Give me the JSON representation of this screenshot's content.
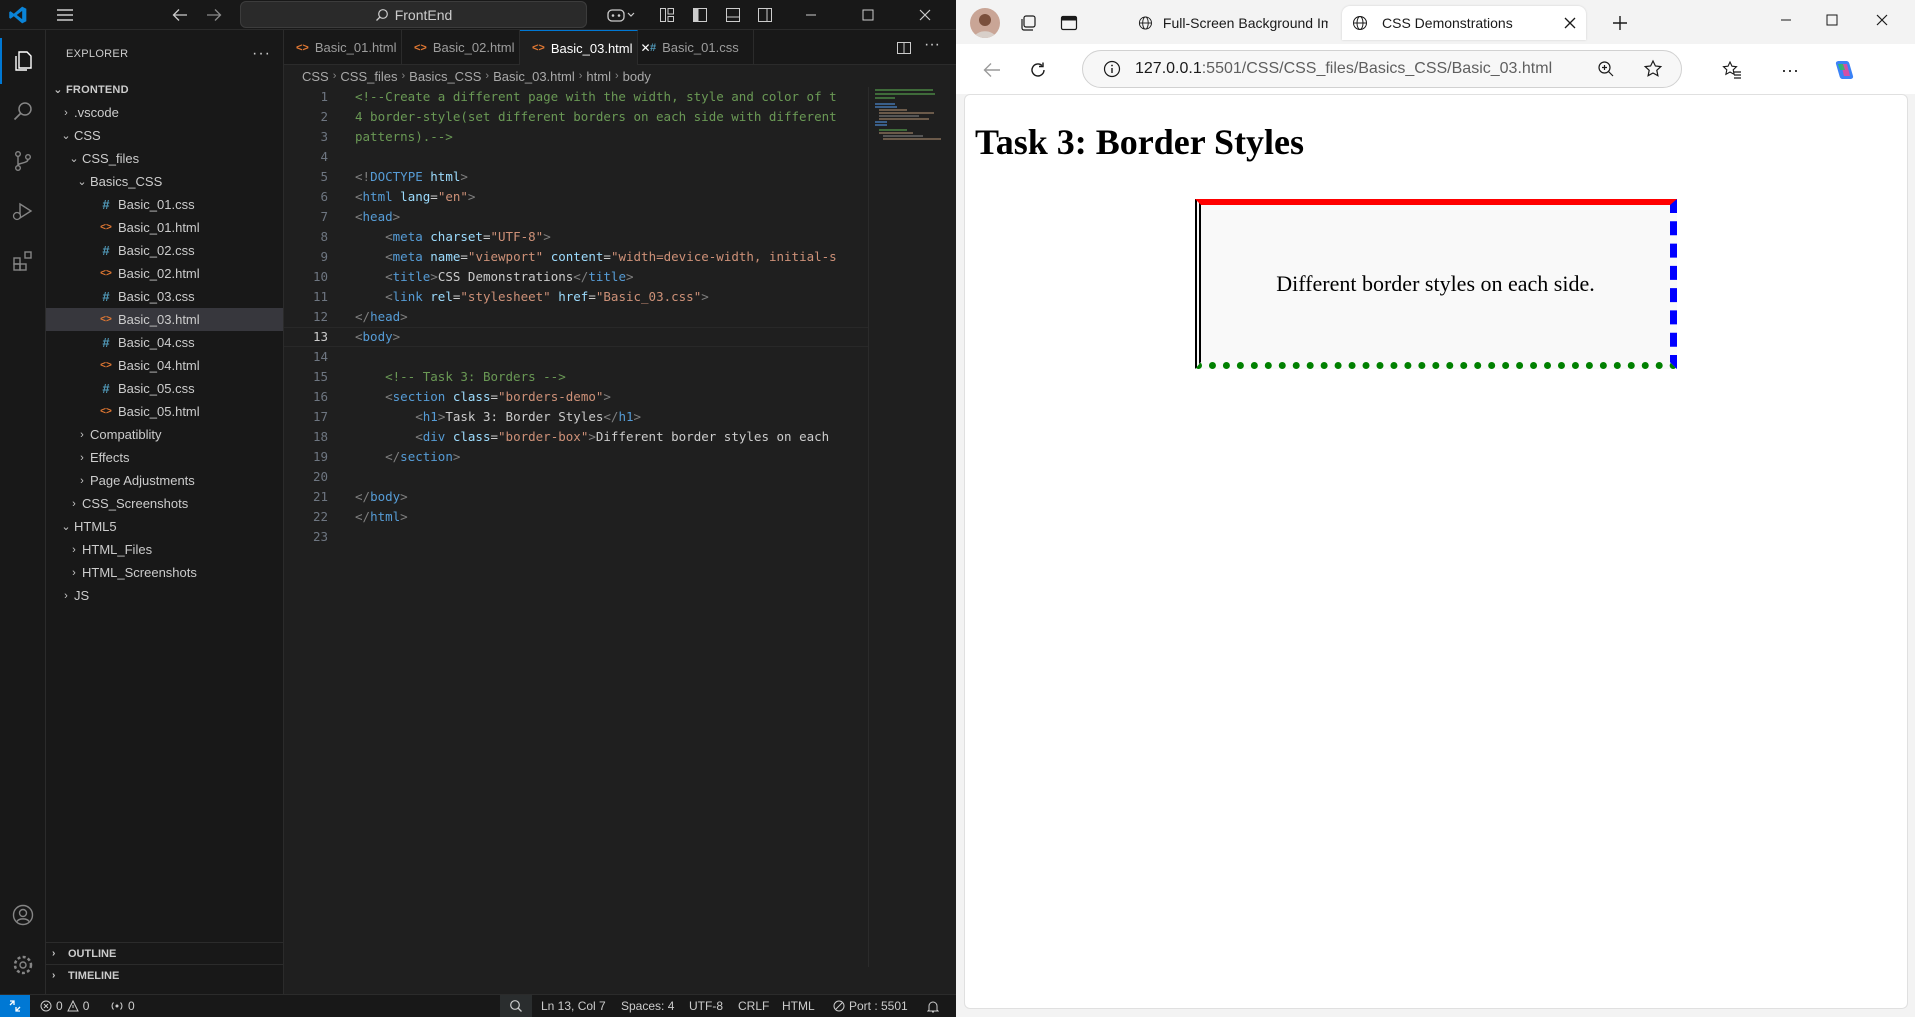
{
  "vscode": {
    "search_label": "FrontEnd",
    "explorer_title": "EXPLORER",
    "root_folder": "FRONTEND",
    "tree": [
      {
        "label": ".vscode",
        "type": "folder",
        "depth": 1,
        "open": false
      },
      {
        "label": "CSS",
        "type": "folder",
        "depth": 1,
        "open": true
      },
      {
        "label": "CSS_files",
        "type": "folder",
        "depth": 2,
        "open": true
      },
      {
        "label": "Basics_CSS",
        "type": "folder",
        "depth": 3,
        "open": true
      },
      {
        "label": "Basic_01.css",
        "type": "css",
        "depth": 4
      },
      {
        "label": "Basic_01.html",
        "type": "html",
        "depth": 4
      },
      {
        "label": "Basic_02.css",
        "type": "css",
        "depth": 4
      },
      {
        "label": "Basic_02.html",
        "type": "html",
        "depth": 4
      },
      {
        "label": "Basic_03.css",
        "type": "css",
        "depth": 4
      },
      {
        "label": "Basic_03.html",
        "type": "html",
        "depth": 4,
        "selected": true
      },
      {
        "label": "Basic_04.css",
        "type": "css",
        "depth": 4
      },
      {
        "label": "Basic_04.html",
        "type": "html",
        "depth": 4
      },
      {
        "label": "Basic_05.css",
        "type": "css",
        "depth": 4
      },
      {
        "label": "Basic_05.html",
        "type": "html",
        "depth": 4
      },
      {
        "label": "Compatiblity",
        "type": "folder",
        "depth": 3,
        "open": false
      },
      {
        "label": "Effects",
        "type": "folder",
        "depth": 3,
        "open": false
      },
      {
        "label": "Page Adjustments",
        "type": "folder",
        "depth": 3,
        "open": false
      },
      {
        "label": "CSS_Screenshots",
        "type": "folder",
        "depth": 2,
        "open": false
      },
      {
        "label": "HTML5",
        "type": "folder",
        "depth": 1,
        "open": true
      },
      {
        "label": "HTML_Files",
        "type": "folder",
        "depth": 2,
        "open": false
      },
      {
        "label": "HTML_Screenshots",
        "type": "folder",
        "depth": 2,
        "open": false
      },
      {
        "label": "JS",
        "type": "folder",
        "depth": 1,
        "open": false
      }
    ],
    "outline_label": "OUTLINE",
    "timeline_label": "TIMELINE",
    "tabs": [
      {
        "label": "Basic_01.html",
        "type": "html",
        "active": false
      },
      {
        "label": "Basic_02.html",
        "type": "html",
        "active": false
      },
      {
        "label": "Basic_03.html",
        "type": "html",
        "active": true
      },
      {
        "label": "Basic_01.css",
        "type": "css",
        "active": false
      }
    ],
    "breadcrumb": [
      "CSS",
      "CSS_files",
      "Basics_CSS",
      "Basic_03.html",
      "html",
      "body"
    ],
    "current_line": 13,
    "code": [
      [
        [
          "c-com",
          "<!--Create a different page with the width, style and color of t"
        ]
      ],
      [
        [
          "c-com",
          "4 border-style(set different borders on each side with different"
        ]
      ],
      [
        [
          "c-com",
          "patterns).-->"
        ]
      ],
      [],
      [
        [
          "c-br",
          "<!"
        ],
        [
          "c-tag",
          "DOCTYPE "
        ],
        [
          "c-att",
          "html"
        ],
        [
          "c-br",
          ">"
        ]
      ],
      [
        [
          "c-br",
          "<"
        ],
        [
          "c-tag",
          "html "
        ],
        [
          "c-att",
          "lang"
        ],
        [
          "c-txt",
          "="
        ],
        [
          "c-str",
          "\"en\""
        ],
        [
          "c-br",
          ">"
        ]
      ],
      [
        [
          "c-br",
          "<"
        ],
        [
          "c-tag",
          "head"
        ],
        [
          "c-br",
          ">"
        ]
      ],
      [
        [
          "c-txt",
          "    "
        ],
        [
          "c-br",
          "<"
        ],
        [
          "c-tag",
          "meta "
        ],
        [
          "c-att",
          "charset"
        ],
        [
          "c-txt",
          "="
        ],
        [
          "c-str",
          "\"UTF-8\""
        ],
        [
          "c-br",
          ">"
        ]
      ],
      [
        [
          "c-txt",
          "    "
        ],
        [
          "c-br",
          "<"
        ],
        [
          "c-tag",
          "meta "
        ],
        [
          "c-att",
          "name"
        ],
        [
          "c-txt",
          "="
        ],
        [
          "c-str",
          "\"viewport\" "
        ],
        [
          "c-att",
          "content"
        ],
        [
          "c-txt",
          "="
        ],
        [
          "c-str",
          "\"width=device-width, initial-s"
        ]
      ],
      [
        [
          "c-txt",
          "    "
        ],
        [
          "c-br",
          "<"
        ],
        [
          "c-tag",
          "title"
        ],
        [
          "c-br",
          ">"
        ],
        [
          "c-txt",
          "CSS Demonstrations"
        ],
        [
          "c-br",
          "</"
        ],
        [
          "c-tag",
          "title"
        ],
        [
          "c-br",
          ">"
        ]
      ],
      [
        [
          "c-txt",
          "    "
        ],
        [
          "c-br",
          "<"
        ],
        [
          "c-tag",
          "link "
        ],
        [
          "c-att",
          "rel"
        ],
        [
          "c-txt",
          "="
        ],
        [
          "c-str",
          "\"stylesheet\" "
        ],
        [
          "c-att",
          "href"
        ],
        [
          "c-txt",
          "="
        ],
        [
          "c-str",
          "\"Basic_03.css\""
        ],
        [
          "c-br",
          ">"
        ]
      ],
      [
        [
          "c-br",
          "</"
        ],
        [
          "c-tag",
          "head"
        ],
        [
          "c-br",
          ">"
        ]
      ],
      [
        [
          "c-br",
          "<"
        ],
        [
          "c-tag",
          "body"
        ],
        [
          "c-br",
          ">"
        ]
      ],
      [],
      [
        [
          "c-txt",
          "    "
        ],
        [
          "c-com",
          "<!-- Task 3: Borders -->"
        ]
      ],
      [
        [
          "c-txt",
          "    "
        ],
        [
          "c-br",
          "<"
        ],
        [
          "c-tag",
          "section "
        ],
        [
          "c-att",
          "class"
        ],
        [
          "c-txt",
          "="
        ],
        [
          "c-str",
          "\"borders-demo\""
        ],
        [
          "c-br",
          ">"
        ]
      ],
      [
        [
          "c-txt",
          "        "
        ],
        [
          "c-br",
          "<"
        ],
        [
          "c-tag",
          "h1"
        ],
        [
          "c-br",
          ">"
        ],
        [
          "c-txt",
          "Task 3: Border Styles"
        ],
        [
          "c-br",
          "</"
        ],
        [
          "c-tag",
          "h1"
        ],
        [
          "c-br",
          ">"
        ]
      ],
      [
        [
          "c-txt",
          "        "
        ],
        [
          "c-br",
          "<"
        ],
        [
          "c-tag",
          "div "
        ],
        [
          "c-att",
          "class"
        ],
        [
          "c-txt",
          "="
        ],
        [
          "c-str",
          "\"border-box\""
        ],
        [
          "c-br",
          ">"
        ],
        [
          "c-txt",
          "Different border styles on each"
        ]
      ],
      [
        [
          "c-txt",
          "    "
        ],
        [
          "c-br",
          "</"
        ],
        [
          "c-tag",
          "section"
        ],
        [
          "c-br",
          ">"
        ]
      ],
      [],
      [
        [
          "c-br",
          "</"
        ],
        [
          "c-tag",
          "body"
        ],
        [
          "c-br",
          ">"
        ]
      ],
      [
        [
          "c-br",
          "</"
        ],
        [
          "c-tag",
          "html"
        ],
        [
          "c-br",
          ">"
        ]
      ],
      []
    ],
    "status": {
      "errors": "0",
      "warnings": "0",
      "ports": "0",
      "position": "Ln 13, Col 7",
      "spaces": "Spaces: 4",
      "encoding": "UTF-8",
      "eol": "CRLF",
      "language": "HTML",
      "port": "Port : 5501"
    }
  },
  "browser": {
    "tabs": [
      {
        "label": "Full-Screen Background Ima",
        "active": false
      },
      {
        "label": "CSS Demonstrations",
        "active": true
      }
    ],
    "url_host": "127.0.0.1",
    "url_path": ":5501/CSS/CSS_files/Basics_CSS/Basic_03.html",
    "page": {
      "heading": "Task 3: Border Styles",
      "box_text": "Different border styles on each side.",
      "border_colors": {
        "top": "#ff0000",
        "right": "#0000ff",
        "bottom": "#008000",
        "left": "#000000"
      },
      "border_styles": {
        "top": "solid",
        "right": "dashed",
        "bottom": "dotted",
        "left": "double"
      }
    }
  },
  "colors": {
    "accent": "#0078d4",
    "editor_bg": "#1f1f1f",
    "sidebar_bg": "#181818"
  }
}
